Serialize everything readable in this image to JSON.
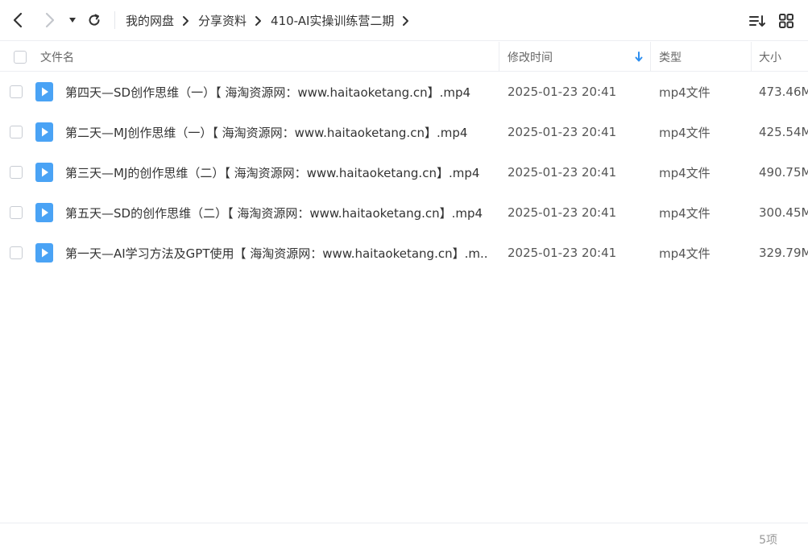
{
  "toolbar": {
    "breadcrumbs": [
      "我的网盘",
      "分享资料",
      "410-AI实操训练营二期"
    ]
  },
  "header": {
    "name": "文件名",
    "modified": "修改时间",
    "type": "类型",
    "size": "大小"
  },
  "files": [
    {
      "name": "第四天—SD创作思维（一）【 海淘资源网：www.haitaoketang.cn】.mp4",
      "modified": "2025-01-23 20:41",
      "type": "mp4文件",
      "size": "473.46M"
    },
    {
      "name": "第二天—MJ创作思维（一）【 海淘资源网：www.haitaoketang.cn】.mp4",
      "modified": "2025-01-23 20:41",
      "type": "mp4文件",
      "size": "425.54M"
    },
    {
      "name": "第三天—MJ的创作思维（二）【 海淘资源网：www.haitaoketang.cn】.mp4",
      "modified": "2025-01-23 20:41",
      "type": "mp4文件",
      "size": "490.75M"
    },
    {
      "name": "第五天—SD的创作思维（二）【 海淘资源网：www.haitaoketang.cn】.mp4",
      "modified": "2025-01-23 20:41",
      "type": "mp4文件",
      "size": "300.45M"
    },
    {
      "name": "第一天—AI学习方法及GPT使用【 海淘资源网：www.haitaoketang.cn】.m...",
      "modified": "2025-01-23 20:41",
      "type": "mp4文件",
      "size": "329.79M"
    }
  ],
  "footer": {
    "count": "5项"
  },
  "colors": {
    "accent": "#2e8ff0",
    "file_icon": "#4aa3f5"
  },
  "icons": [
    "back-arrow-icon",
    "forward-arrow-icon",
    "dropdown-caret-icon",
    "refresh-icon",
    "chevron-right-icon",
    "sort-list-icon",
    "grid-view-icon",
    "sort-desc-arrow-icon",
    "video-file-icon"
  ]
}
